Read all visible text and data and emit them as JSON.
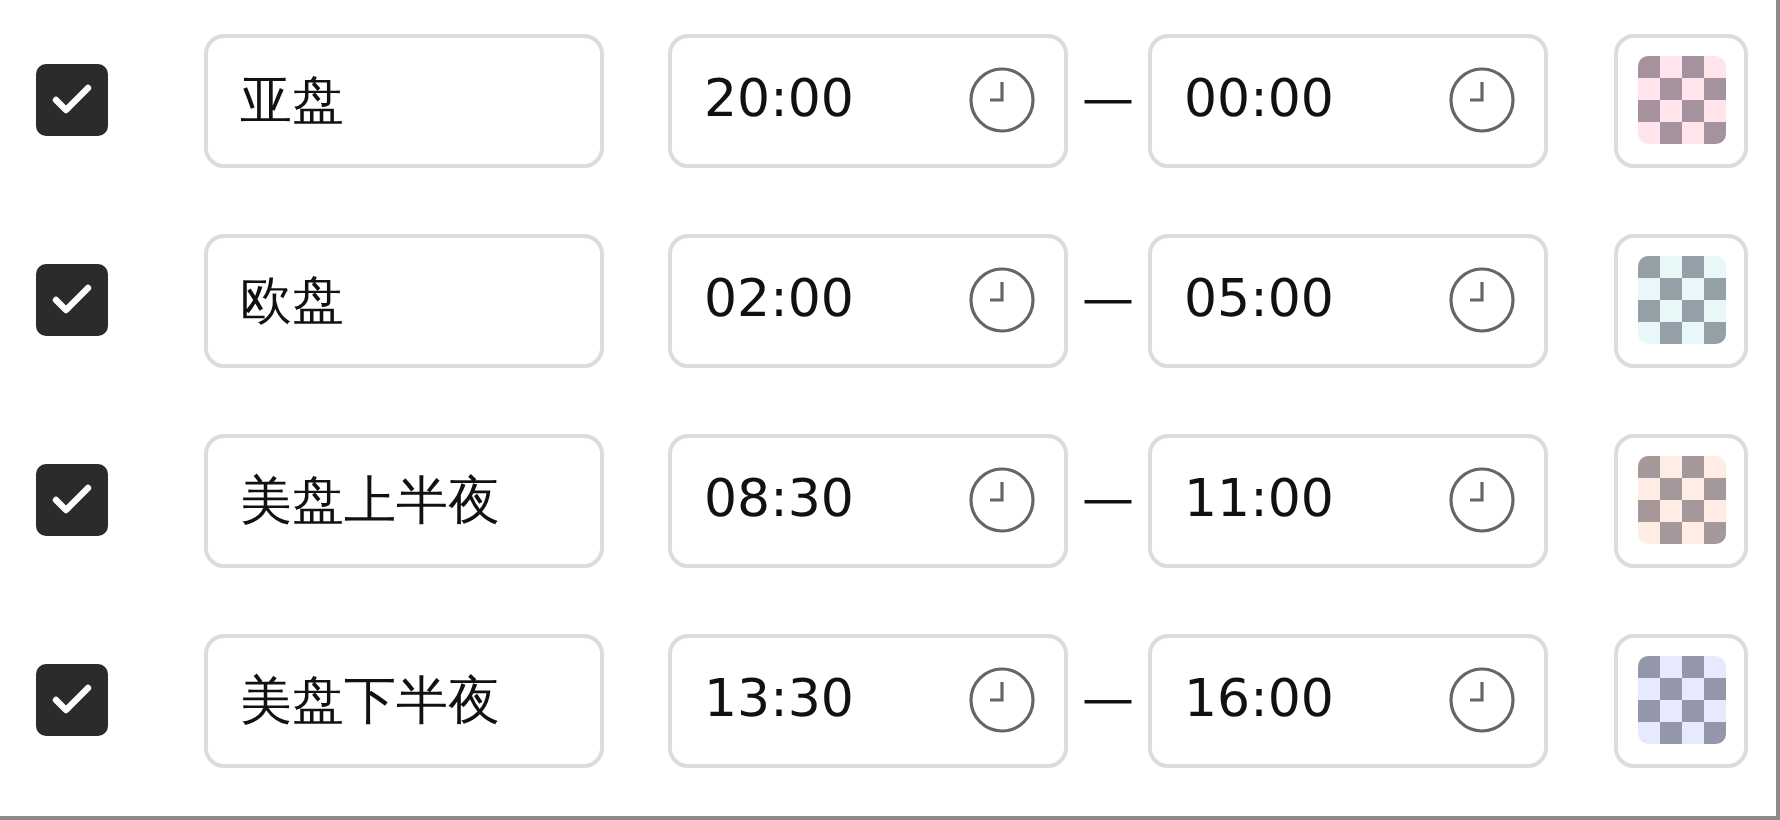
{
  "rows": [
    {
      "checked": true,
      "name": "亚盘",
      "start": "20:00",
      "separator": "—",
      "end": "00:00",
      "color": "#ffe4ec"
    },
    {
      "checked": true,
      "name": "欧盘",
      "start": "02:00",
      "separator": "—",
      "end": "05:00",
      "color": "#e8f7f8"
    },
    {
      "checked": true,
      "name": "美盘上半夜",
      "start": "08:30",
      "separator": "—",
      "end": "11:00",
      "color": "#ffece4"
    },
    {
      "checked": true,
      "name": "美盘下半夜",
      "start": "13:30",
      "separator": "—",
      "end": "16:00",
      "color": "#e6eafc"
    }
  ]
}
